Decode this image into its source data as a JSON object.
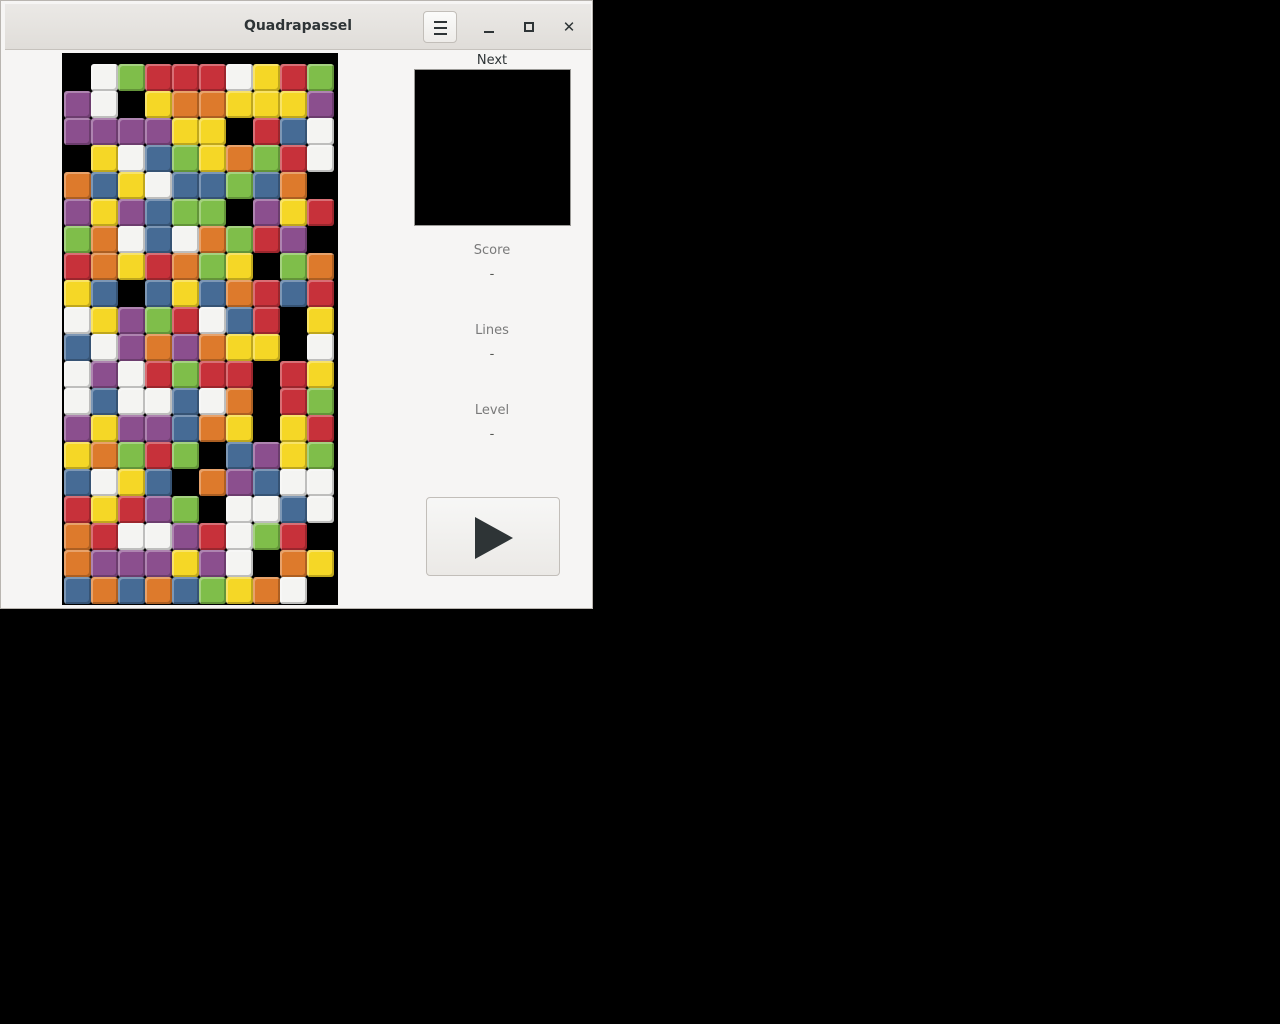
{
  "window": {
    "title": "Quadrapassel"
  },
  "sidebar": {
    "next_label": "Next",
    "score_label": "Score",
    "score_value": "-",
    "lines_label": "Lines",
    "lines_value": "-",
    "level_label": "Level",
    "level_value": "-"
  },
  "icons": {
    "menu": "hamburger-menu-icon",
    "minimize": "minimize-icon",
    "maximize": "maximize-icon",
    "close": "close-icon",
    "play": "play-icon"
  },
  "colors": {
    "R": "#c7313a",
    "O": "#dd7a2c",
    "Y": "#f5d726",
    "G": "#7fbe4a",
    "B": "#466b95",
    "P": "#8b4f8e",
    "W": "#f4f4f2",
    "K": "#000000"
  },
  "board": {
    "columns": 10,
    "rows": 20,
    "cells": [
      "KWGRRRWYRG",
      "PWKYOOYYYP",
      "PPPPYYKRBW",
      "KYWBGYOGRW",
      "OBYWBBGBOK",
      "PYPBGGKPYR",
      "GOWBWOGRPK",
      "ROYROGYKGO",
      "YBKBYBORBR",
      "WYPGRWBRKY",
      "BWPOPOYYKW",
      "WPWRGRRKRY",
      "WBWWBWOKRG",
      "PYPPBOYKYR",
      "YOGRGKBPYG",
      "BWYBKOPBWW",
      "RYRPGKWWBW",
      "ORWWPRWGRK",
      "OPPPYPWKOY",
      "BOBOBGYOWK"
    ]
  }
}
